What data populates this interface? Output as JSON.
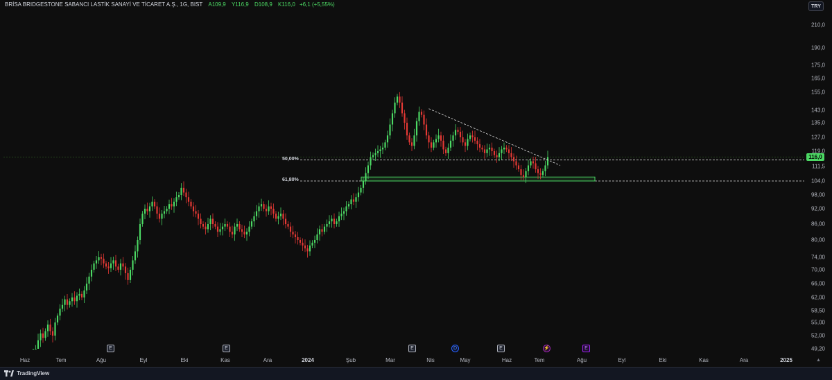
{
  "legend": {
    "symbol": "BRİSA BRIDGESTONE SABANCI LASTİK SANAYİ VE TİCARET A.Ş., 1G, BIST",
    "open": "A109,9",
    "high": "Y116,9",
    "low": "D108,9",
    "close": "K116,0",
    "change": "+6,1 (+5,55%)"
  },
  "currency_button": "TRY",
  "last_price": "116,0",
  "y_axis_labels": [
    "210,0",
    "190,0",
    "175,0",
    "165,0",
    "155,0",
    "143,0",
    "135,0",
    "127,0",
    "119,0",
    "111,5",
    "104,0",
    "98,00",
    "92,00",
    "86,00",
    "80,00",
    "74,00",
    "70,00",
    "66,00",
    "62,00",
    "58,50",
    "55,00",
    "52,00",
    "49,20"
  ],
  "x_axis_labels": [
    "Haz",
    "Tem",
    "Ağu",
    "Eyl",
    "Eki",
    "Kas",
    "Ara",
    "2024",
    "Şub",
    "Mar",
    "Nis",
    "May",
    "Haz",
    "Tem",
    "Ağu",
    "Eyl",
    "Eki",
    "Kas",
    "Ara",
    "2025"
  ],
  "fib_levels": [
    {
      "label": "50,00%",
      "price": 114.6
    },
    {
      "label": "61,80%",
      "price": 104.0
    }
  ],
  "events": [
    {
      "type": "E",
      "style": "earnings"
    },
    {
      "type": "E",
      "style": "earnings"
    },
    {
      "type": "E",
      "style": "earnings"
    },
    {
      "type": "D",
      "style": "dividend"
    },
    {
      "type": "E",
      "style": "earnings"
    },
    {
      "type": "⚡",
      "style": "split"
    },
    {
      "type": "E",
      "style": "earnings-upcoming"
    }
  ],
  "colors": {
    "up": "#4cd964",
    "down": "#e53935",
    "background": "#0e0e0e",
    "support_box": "#4cd964"
  },
  "brand": "TradingView",
  "chart_data": {
    "type": "candlestick",
    "axis_scale": "log",
    "ylim": [
      47,
      230
    ],
    "closes": [
      47.5,
      49,
      51,
      52.5,
      51.5,
      53,
      54.5,
      53,
      52,
      55,
      57,
      59,
      60,
      61.5,
      60,
      61,
      62,
      61,
      62.5,
      63,
      62,
      64,
      66,
      68,
      70,
      72,
      73,
      74,
      73.5,
      72,
      71,
      70.5,
      72,
      73,
      71,
      70,
      72,
      71,
      69,
      67,
      70,
      73,
      76,
      80,
      86,
      90,
      92,
      91,
      93,
      95,
      93,
      90,
      88,
      90,
      91,
      92,
      94,
      93,
      95,
      97,
      98,
      101,
      99,
      97,
      95,
      93,
      91,
      90,
      88,
      86,
      85,
      84,
      86,
      88,
      86,
      85,
      83,
      84,
      85,
      86,
      85,
      83,
      82,
      85,
      86,
      84,
      83,
      82,
      83,
      85,
      87,
      89,
      91,
      93,
      94,
      92,
      91,
      93,
      92,
      90,
      88,
      89,
      90,
      88,
      86,
      85,
      83,
      82,
      81,
      80,
      79,
      78,
      77,
      76,
      78,
      79,
      80,
      82,
      84,
      83,
      85,
      86,
      87,
      88,
      86,
      87,
      89,
      90,
      91,
      93,
      94,
      96,
      95,
      97,
      99,
      101,
      104,
      108,
      112,
      116,
      117,
      118,
      119,
      120,
      121,
      124,
      128,
      134,
      141,
      148,
      152,
      148,
      141,
      135,
      128,
      124,
      122,
      128,
      136,
      142,
      140,
      134,
      128,
      124,
      121,
      124,
      126,
      128,
      125,
      120,
      118,
      121,
      125,
      128,
      131,
      130,
      127,
      124,
      122,
      126,
      128,
      127,
      125,
      123,
      121,
      120,
      118,
      120,
      121,
      119,
      117,
      116,
      118,
      120,
      121,
      120,
      118,
      116,
      114,
      112,
      110,
      107,
      106,
      109,
      112,
      114,
      113,
      110,
      108,
      107,
      109,
      112,
      116
    ]
  }
}
